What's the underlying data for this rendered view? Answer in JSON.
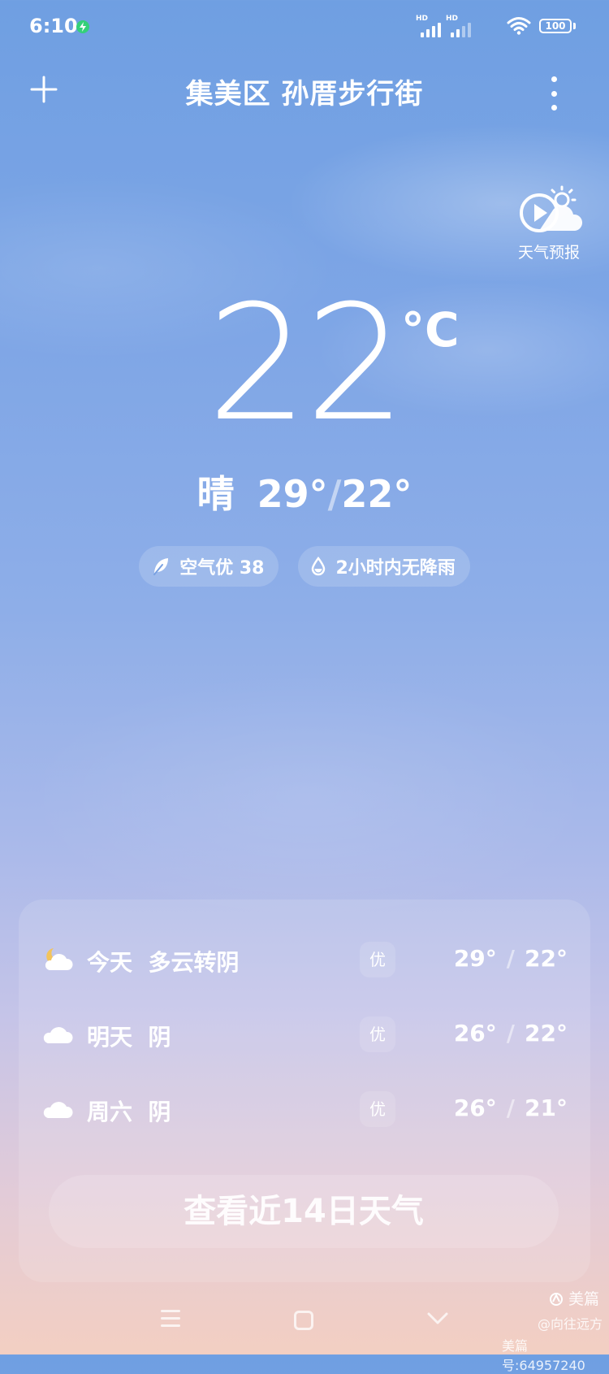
{
  "status_bar": {
    "time": "6:10",
    "sim1_label": "HD",
    "sim2_label": "HD",
    "battery_level": "100"
  },
  "header": {
    "location": "集美区 孙厝步行街"
  },
  "forecast_video": {
    "label": "天气预报"
  },
  "current": {
    "temperature": "22",
    "unit": "°C",
    "condition": "晴",
    "high": "29°",
    "low": "22°"
  },
  "chips": {
    "air_quality": "空气优 38",
    "rain": "2小时内无降雨"
  },
  "forecast": [
    {
      "day": "今天",
      "condition": "多云转阴",
      "aqi": "优",
      "high": "29°",
      "low": "22°",
      "icon": "partly-cloudy-night-icon"
    },
    {
      "day": "明天",
      "condition": "阴",
      "aqi": "优",
      "high": "26°",
      "low": "22°",
      "icon": "cloud-icon"
    },
    {
      "day": "周六",
      "condition": "阴",
      "aqi": "优",
      "high": "26°",
      "low": "21°",
      "icon": "cloud-icon"
    }
  ],
  "fourteen_day_button": "查看近14日天气",
  "watermark": {
    "brand": "美篇",
    "author": "@向往远方",
    "id": "美篇号:64957240"
  },
  "colors": {
    "sky_top": "#6f9fe2",
    "sky_bottom": "#f3cfc2",
    "charging_green": "#34d07a"
  }
}
